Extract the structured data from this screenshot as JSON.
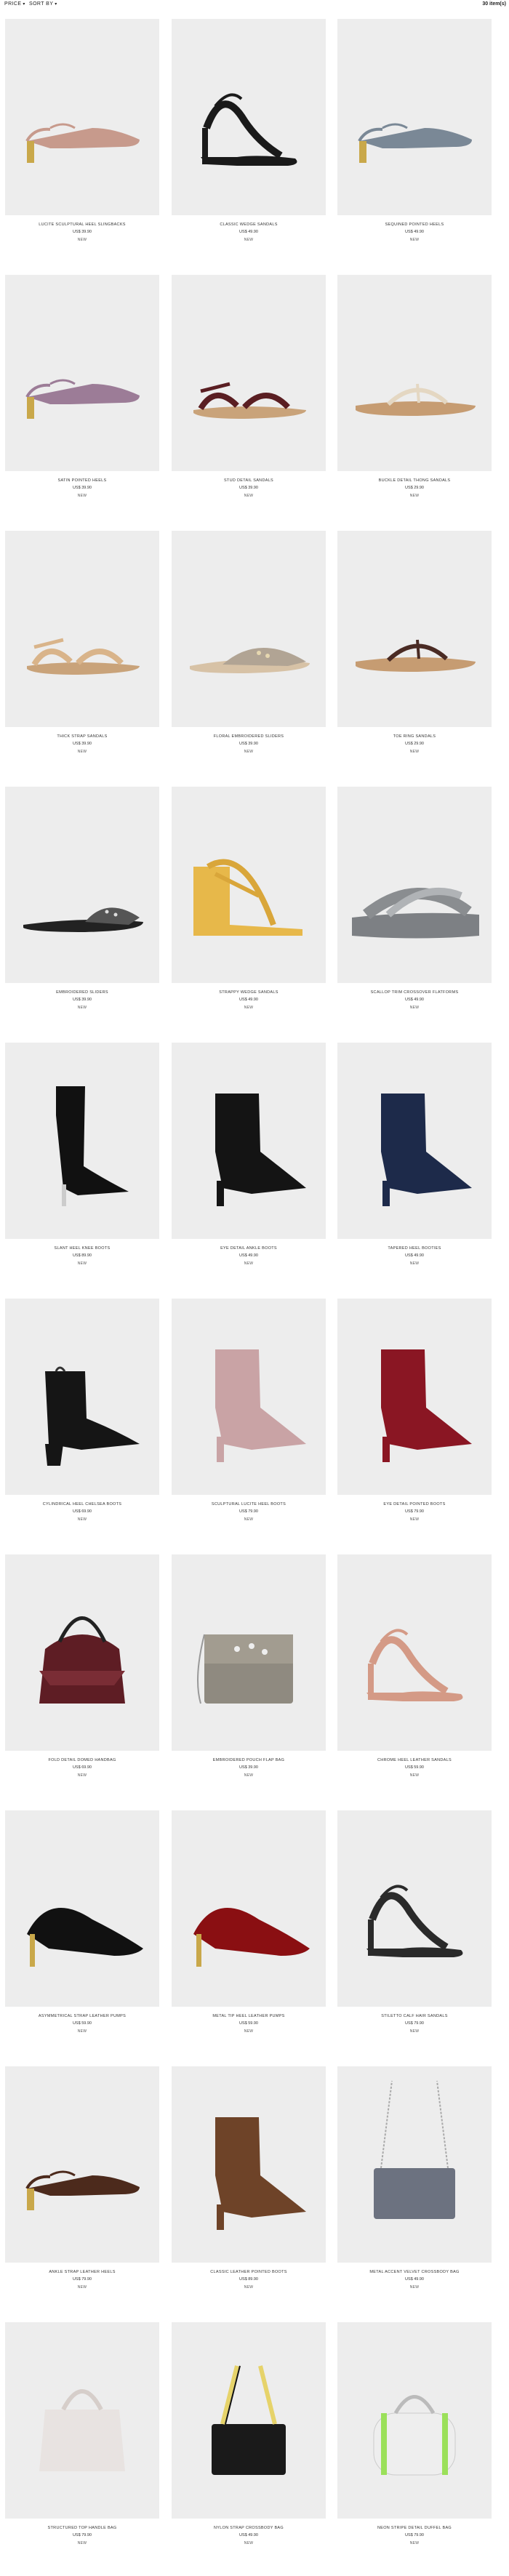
{
  "toolbar": {
    "price_label": "PRICE",
    "sort_label": "SORT BY",
    "count_label": "30 item(s)"
  },
  "products": [
    {
      "name": "LUCITE SCULPTURAL HEEL SLINGBACKS",
      "price": "US$ 39.90",
      "action": "NEW",
      "icon": "slingback-heel-icon",
      "color": "#c79a8c"
    },
    {
      "name": "CLASSIC WEDGE SANDALS",
      "price": "US$ 49.90",
      "action": "NEW",
      "icon": "heeled-sandal-icon",
      "color": "#1a1a1a"
    },
    {
      "name": "SEQUINED POINTED HEELS",
      "price": "US$ 49.90",
      "action": "NEW",
      "icon": "slingback-heel-icon",
      "color": "#7a8896"
    },
    {
      "name": "SATIN POINTED HEELS",
      "price": "US$ 39.90",
      "action": "NEW",
      "icon": "slingback-heel-icon",
      "color": "#9c7c97"
    },
    {
      "name": "STUD DETAIL SANDALS",
      "price": "US$ 39.90",
      "action": "NEW",
      "icon": "flat-sandal-icon",
      "color": "#5a1e22"
    },
    {
      "name": "BUCKLE DETAIL THONG SANDALS",
      "price": "US$ 29.90",
      "action": "NEW",
      "icon": "thong-sandal-icon",
      "color": "#e4d7c2"
    },
    {
      "name": "THICK STRAP SANDALS",
      "price": "US$ 39.90",
      "action": "NEW",
      "icon": "flat-sandal-icon",
      "color": "#d9b48a"
    },
    {
      "name": "FLORAL EMBROIDERED SLIDERS",
      "price": "US$ 39.90",
      "action": "NEW",
      "icon": "mule-icon",
      "color": "#b1a494"
    },
    {
      "name": "TOE RING SANDALS",
      "price": "US$ 29.90",
      "action": "NEW",
      "icon": "thong-sandal-icon",
      "color": "#4a2b24"
    },
    {
      "name": "EMBROIDERED SLIDERS",
      "price": "US$ 39.90",
      "action": "NEW",
      "icon": "slider-icon",
      "color": "#222222"
    },
    {
      "name": "STRAPPY WEDGE SANDALS",
      "price": "US$ 49.90",
      "action": "NEW",
      "icon": "wedge-sandal-icon",
      "color": "#e7b84a"
    },
    {
      "name": "SCALLOP TRIM CROSSOVER FLATFORMS",
      "price": "US$ 49.90",
      "action": "NEW",
      "icon": "flatform-icon",
      "color": "#8a8d90"
    },
    {
      "name": "SLANT HEEL KNEE BOOTS",
      "price": "US$ 89.90",
      "action": "NEW",
      "icon": "knee-boot-icon",
      "color": "#111111"
    },
    {
      "name": "EYE DETAIL ANKLE BOOTS",
      "price": "US$ 49.90",
      "action": "NEW",
      "icon": "ankle-boot-icon",
      "color": "#141414"
    },
    {
      "name": "TAPERED HEEL BOOTIES",
      "price": "US$ 49.90",
      "action": "NEW",
      "icon": "ankle-boot-icon",
      "color": "#1d2a4a"
    },
    {
      "name": "CYLINDRICAL HEEL CHELSEA BOOTS",
      "price": "US$ 69.90",
      "action": "NEW",
      "icon": "chelsea-boot-icon",
      "color": "#151515"
    },
    {
      "name": "SCULPTURAL LUCITE HEEL BOOTS",
      "price": "US$ 79.90",
      "action": "NEW",
      "icon": "ankle-boot-icon",
      "color": "#c9a3a5"
    },
    {
      "name": "EYE DETAIL POINTED BOOTS",
      "price": "US$ 79.90",
      "action": "NEW",
      "icon": "ankle-boot-icon",
      "color": "#8a1623"
    },
    {
      "name": "FOLD DETAIL DOMED HANDBAG",
      "price": "US$ 69.90",
      "action": "NEW",
      "icon": "domed-handbag-icon",
      "color": "#5e1d24"
    },
    {
      "name": "EMBROIDERED POUCH FLAP BAG",
      "price": "US$ 39.90",
      "action": "NEW",
      "icon": "flap-bag-icon",
      "color": "#8f8a80"
    },
    {
      "name": "CHROME HEEL LEATHER SANDALS",
      "price": "US$ 59.90",
      "action": "NEW",
      "icon": "heeled-sandal-icon",
      "color": "#d49a86"
    },
    {
      "name": "ASYMMETRICAL STRAP LEATHER PUMPS",
      "price": "US$ 59.90",
      "action": "NEW",
      "icon": "pump-icon",
      "color": "#111111"
    },
    {
      "name": "METAL TIP HEEL LEATHER PUMPS",
      "price": "US$ 59.90",
      "action": "NEW",
      "icon": "pump-icon",
      "color": "#8a0f12"
    },
    {
      "name": "STILETTO CALF HAIR SANDALS",
      "price": "US$ 79.90",
      "action": "NEW",
      "icon": "heeled-sandal-icon",
      "color": "#2a2a2a"
    },
    {
      "name": "ANKLE STRAP LEATHER HEELS",
      "price": "US$ 79.90",
      "action": "NEW",
      "icon": "slingback-heel-icon",
      "color": "#4c2a1c"
    },
    {
      "name": "CLASSIC LEATHER POINTED BOOTS",
      "price": "US$ 89.90",
      "action": "NEW",
      "icon": "ankle-boot-icon",
      "color": "#6e4328"
    },
    {
      "name": "METAL ACCENT VELVET CROSSBODY BAG",
      "price": "US$ 49.90",
      "action": "NEW",
      "icon": "crossbody-bag-icon",
      "color": "#6c7280"
    },
    {
      "name": "STRUCTURED TOP HANDLE BAG",
      "price": "US$ 79.90",
      "action": "NEW",
      "icon": "tote-bag-icon",
      "color": "#e8e3e1"
    },
    {
      "name": "NYLON STRAP CROSSBODY BAG",
      "price": "US$ 49.90",
      "action": "NEW",
      "icon": "camera-bag-icon",
      "color": "#1a1a1a"
    },
    {
      "name": "NEON STRIPE DETAIL DUFFEL BAG",
      "price": "US$ 79.90",
      "action": "NEW",
      "icon": "duffel-bag-icon",
      "color": "#eeeeee"
    }
  ]
}
